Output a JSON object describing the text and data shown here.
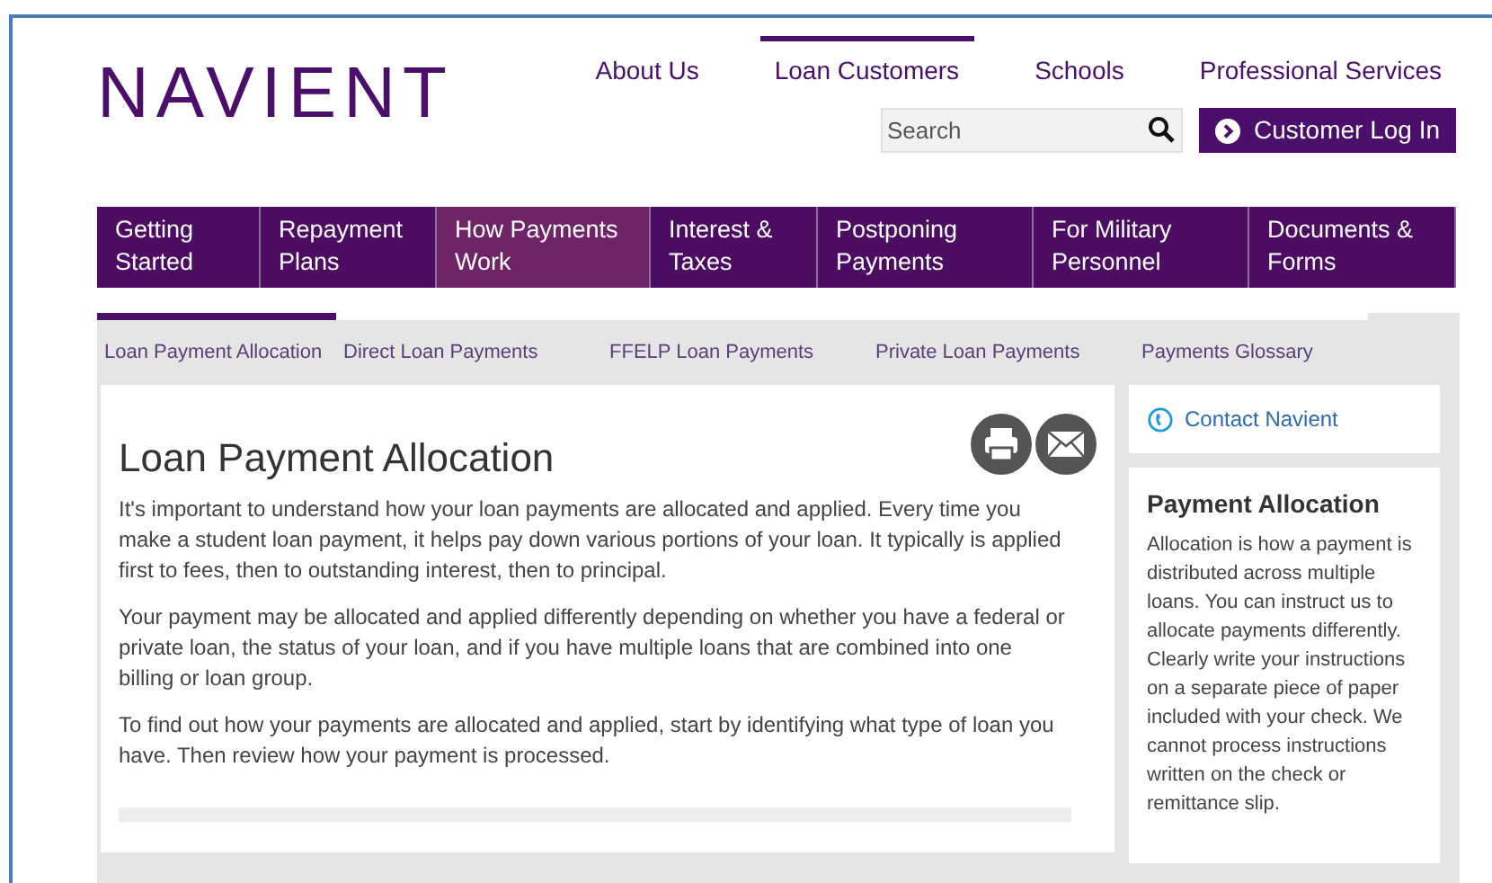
{
  "logo": {
    "text": "NAVIENT"
  },
  "top_links": [
    {
      "label": "About Us",
      "selected": false
    },
    {
      "label": "Loan Customers",
      "selected": true
    },
    {
      "label": "Schools",
      "selected": false
    },
    {
      "label": "Professional Services",
      "selected": false
    }
  ],
  "search": {
    "placeholder": "Search"
  },
  "login_button": {
    "label": "Customer Log In"
  },
  "main_nav": [
    {
      "label": "Getting Started",
      "selected": false
    },
    {
      "label": "Repayment Plans",
      "selected": false
    },
    {
      "label": "How Payments Work",
      "selected": true
    },
    {
      "label": "Interest & Taxes",
      "selected": false
    },
    {
      "label": "Postponing Payments",
      "selected": false
    },
    {
      "label": "For Military Personnel",
      "selected": false
    },
    {
      "label": "Documents & Forms",
      "selected": false
    }
  ],
  "sub_nav": [
    {
      "label": "Loan Payment Allocation",
      "selected": true
    },
    {
      "label": "Direct Loan Payments",
      "selected": false
    },
    {
      "label": "FFELP Loan Payments",
      "selected": false
    },
    {
      "label": "Private Loan Payments",
      "selected": false
    },
    {
      "label": "Payments Glossary",
      "selected": false
    }
  ],
  "article": {
    "title": "Loan Payment Allocation",
    "paragraphs": [
      "It's important to understand how your loan payments are allocated and applied. Every time you make a student loan payment, it helps pay down various portions of your loan. It typically is applied first to fees, then to outstanding interest, then to principal.",
      "Your payment may be allocated and applied differently depending on whether you have a federal or private loan, the status of your loan, and if you have multiple loans that are combined into one billing or loan group.",
      "To find out how your payments are allocated and applied, start by identifying what type of loan you have. Then review how your payment is processed."
    ]
  },
  "sidebar": {
    "contact_link": "Contact Navient",
    "box_title": "Payment Allocation",
    "box_text": "Allocation is how a payment is distributed across multiple loans. You can instruct us to allocate payments differently. Clearly write your instructions on a separate piece of paper included with your check. We cannot process instructions written on the check or remittance slip."
  }
}
